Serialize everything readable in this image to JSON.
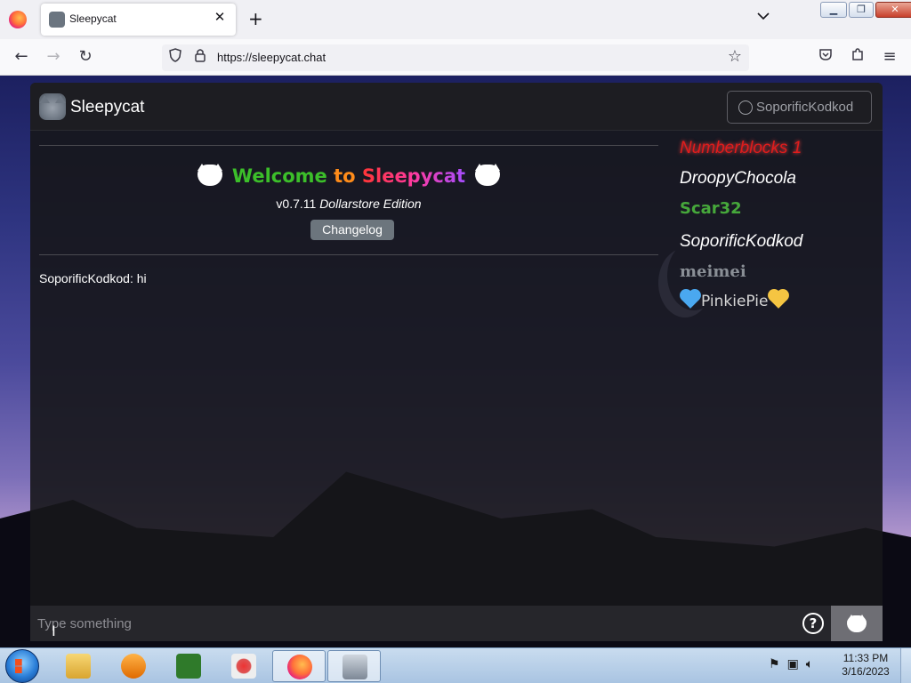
{
  "browser": {
    "tab_title": "Sleepycat",
    "tab_close": "✕",
    "new_tab": "+",
    "url": "https://sleepycat.chat"
  },
  "app": {
    "name": "Sleepycat",
    "user_button": "SoporificKodkod",
    "welcome": {
      "part1": "Welcome",
      "part2": "to",
      "part3": "Sleepycat"
    },
    "version": "v0.7.11",
    "edition": "Dollarstore Edition",
    "changelog_label": "Changelog",
    "messages": [
      {
        "text": "SoporificKodkod: hi"
      }
    ],
    "users": [
      "Numberblocks 1",
      "DroopyChocola",
      "Scar32",
      "SoporificKodkod",
      "meimei",
      "PinkiePie"
    ],
    "input_placeholder": "Type something",
    "help_label": "?"
  },
  "taskbar": {
    "time": "11:33 PM",
    "date": "3/16/2023"
  },
  "colors": {
    "app_bg": "#16161a",
    "header_bg": "#1d1d22",
    "changelog_bg": "#6c757d",
    "user1": "#e01c1c",
    "user3": "#46a83b",
    "user5": "#8a8f96"
  }
}
